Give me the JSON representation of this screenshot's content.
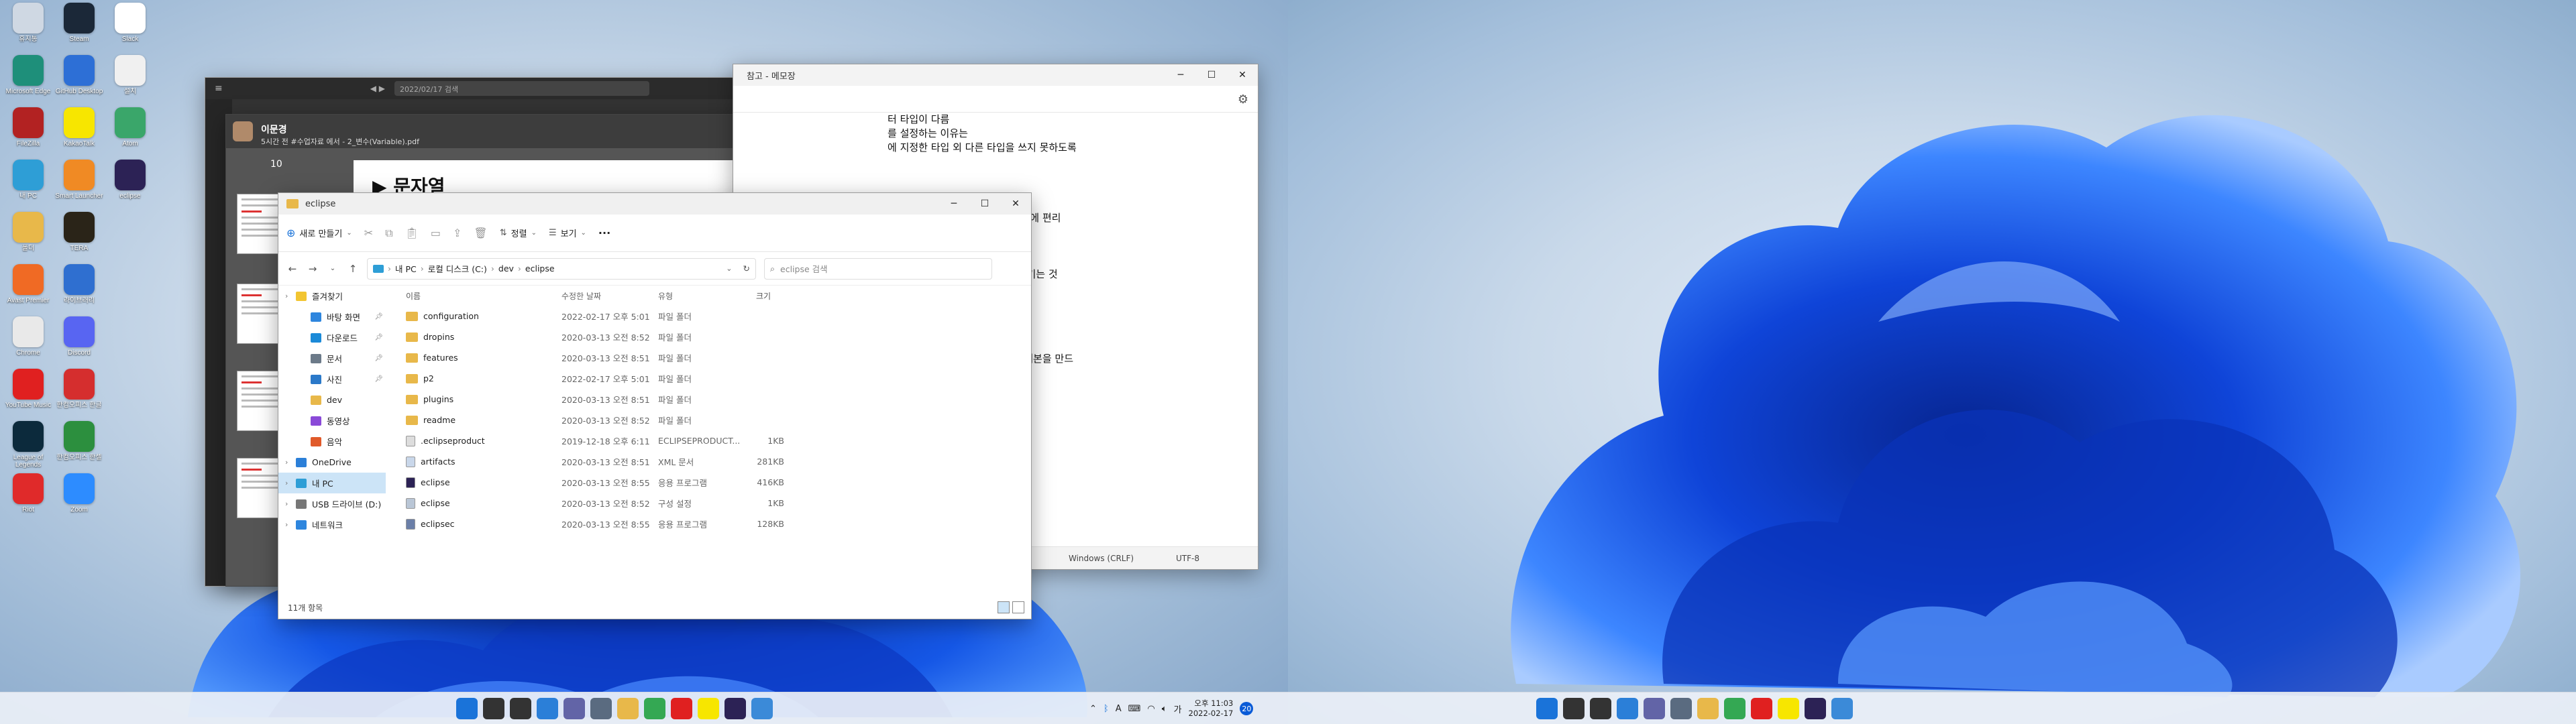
{
  "desktop_icons": [
    {
      "label": "휴지통",
      "icon": "recycle-bin-icon",
      "color": "#cfd8e3"
    },
    {
      "label": "Steam",
      "icon": "steam-icon",
      "color": "#1b2838"
    },
    {
      "label": "Slack",
      "icon": "slack-icon",
      "color": "#ffffff"
    },
    {
      "label": "Microsoft Edge",
      "icon": "edge-icon",
      "color": "#1e8f7a"
    },
    {
      "label": "GitHub Desktop",
      "icon": "github-desktop-icon",
      "color": "#2d6fd6"
    },
    {
      "label": "설치",
      "icon": "document-icon",
      "color": "#f0f0f0"
    },
    {
      "label": "FileZilla",
      "icon": "filezilla-icon",
      "color": "#b22222"
    },
    {
      "label": "KakaoTalk",
      "icon": "kakaotalk-icon",
      "color": "#f7e600"
    },
    {
      "label": "Atom",
      "icon": "atom-icon",
      "color": "#3aa66a"
    },
    {
      "label": "내 PC",
      "icon": "monitor-icon",
      "color": "#2e9ed6"
    },
    {
      "label": "Smart Launcher",
      "icon": "s-app-icon",
      "color": "#f08a24"
    },
    {
      "label": "eclipse",
      "icon": "eclipse-icon",
      "color": "#2c2255"
    },
    {
      "label": "폴더",
      "icon": "folder-icon",
      "color": "#e8b84a"
    },
    {
      "label": "TERA",
      "icon": "game-t-icon",
      "color": "#2a2418"
    },
    {
      "label": "",
      "icon": "blank",
      "color": "transparent"
    },
    {
      "label": "Avast Premier",
      "icon": "avast-icon",
      "color": "#f06a24"
    },
    {
      "label": "라이브러리",
      "icon": "bolt-app-icon",
      "color": "#2f6fd0"
    },
    {
      "label": "",
      "icon": "blank",
      "color": "transparent"
    },
    {
      "label": "Chrome",
      "icon": "chrome-icon",
      "color": "#e9e9e9"
    },
    {
      "label": "Discord",
      "icon": "discord-icon",
      "color": "#5865f2"
    },
    {
      "label": "",
      "icon": "blank",
      "color": "transparent"
    },
    {
      "label": "YouTube Music",
      "icon": "youtube-music-icon",
      "color": "#e02020"
    },
    {
      "label": "한컴오피스 한글",
      "icon": "hancom-icon",
      "color": "#d52e2e"
    },
    {
      "label": "",
      "icon": "blank",
      "color": "transparent"
    },
    {
      "label": "League of Legends",
      "icon": "lol-icon",
      "color": "#0c2a3c"
    },
    {
      "label": "한컴오피스 한셀",
      "icon": "hancell-icon",
      "color": "#2c8f3e"
    },
    {
      "label": "",
      "icon": "blank",
      "color": "transparent"
    },
    {
      "label": "Riot",
      "icon": "riot-icon",
      "color": "#e02a2a"
    },
    {
      "label": "Zoom",
      "icon": "zoom-icon",
      "color": "#2d8cff"
    }
  ],
  "pdf_window": {
    "search_placeholder": "2022/02/17 검색",
    "sender": "이문경",
    "meta": "5시간 전 #수업자료 에서 - 2_변수(Variable).pdf",
    "page_number": "10",
    "page_heading": "▶ 문자열"
  },
  "notepad": {
    "title": "참고 - 메모장",
    "lines": [
      "터 타입이 다름",
      "를 설정하는 이유는",
      "에 지정한 타입 외 다른 타입을 쓰지 못하도록",
      "",
      "",
      "",
      "",
      "사용된 요소가 한번에 바뀌기 때문에 편리",
      "있도록 하는 것이 중요",
      "",
      "것",
      "접하여 자동화하여 순차적으로 시키는 것",
      "",
      "",
      "",
      "",
      "들인 것",
      "값과 서로 같은 메소드를 가진 복제본을 만드"
    ],
    "status_encoding_line": "Windows (CRLF)",
    "status_charset": "UTF-8"
  },
  "explorer": {
    "title": "eclipse",
    "toolbar": {
      "new": "새로 만들기",
      "sort": "정렬",
      "view": "보기",
      "more": "···"
    },
    "address": [
      "내 PC",
      "로컬 디스크 (C:)",
      "dev",
      "eclipse"
    ],
    "search_placeholder": "eclipse 검색",
    "nav": [
      {
        "label": "즐겨찾기",
        "icon": "star-icon",
        "color": "#f2c531",
        "pinned": false,
        "indent": 0,
        "selected": false
      },
      {
        "label": "바탕 화면",
        "icon": "desktop-icon",
        "color": "#2e86de",
        "pinned": true,
        "indent": 1,
        "selected": false
      },
      {
        "label": "다운로드",
        "icon": "download-icon",
        "color": "#1b8ad8",
        "pinned": true,
        "indent": 1,
        "selected": false
      },
      {
        "label": "문서",
        "icon": "documents-icon",
        "color": "#6c7a89",
        "pinned": true,
        "indent": 1,
        "selected": false
      },
      {
        "label": "사진",
        "icon": "pictures-icon",
        "color": "#2b79c9",
        "pinned": true,
        "indent": 1,
        "selected": false
      },
      {
        "label": "dev",
        "icon": "folder-icon",
        "color": "#e8b84a",
        "pinned": false,
        "indent": 1,
        "selected": false
      },
      {
        "label": "동영상",
        "icon": "videos-icon",
        "color": "#8a4ad8",
        "pinned": false,
        "indent": 1,
        "selected": false
      },
      {
        "label": "음악",
        "icon": "music-icon",
        "color": "#e05a2a",
        "pinned": false,
        "indent": 1,
        "selected": false
      },
      {
        "label": "OneDrive",
        "icon": "onedrive-icon",
        "color": "#2b7fd8",
        "pinned": false,
        "indent": 0,
        "selected": false
      },
      {
        "label": "내 PC",
        "icon": "pc-icon",
        "color": "#2e9ed6",
        "pinned": false,
        "indent": 0,
        "selected": true
      },
      {
        "label": "USB 드라이브 (D:)",
        "icon": "usb-drive-icon",
        "color": "#777777",
        "pinned": false,
        "indent": 0,
        "selected": false
      },
      {
        "label": "네트워크",
        "icon": "network-icon",
        "color": "#2e86de",
        "pinned": false,
        "indent": 0,
        "selected": false
      }
    ],
    "columns": {
      "name": "이름",
      "date": "수정한 날짜",
      "type": "유형",
      "size": "크기"
    },
    "files": [
      {
        "name": "configuration",
        "date": "2022-02-17 오후 5:01",
        "type": "파일 폴더",
        "size": "",
        "icon": "folder-icon",
        "color": "#e8b84a"
      },
      {
        "name": "dropins",
        "date": "2020-03-13 오전 8:52",
        "type": "파일 폴더",
        "size": "",
        "icon": "folder-icon",
        "color": "#e8b84a"
      },
      {
        "name": "features",
        "date": "2020-03-13 오전 8:51",
        "type": "파일 폴더",
        "size": "",
        "icon": "folder-icon",
        "color": "#e8b84a"
      },
      {
        "name": "p2",
        "date": "2022-02-17 오후 5:01",
        "type": "파일 폴더",
        "size": "",
        "icon": "folder-icon",
        "color": "#e8b84a"
      },
      {
        "name": "plugins",
        "date": "2020-03-13 오전 8:51",
        "type": "파일 폴더",
        "size": "",
        "icon": "folder-icon",
        "color": "#e8b84a"
      },
      {
        "name": "readme",
        "date": "2020-03-13 오전 8:52",
        "type": "파일 폴더",
        "size": "",
        "icon": "folder-icon",
        "color": "#e8b84a"
      },
      {
        "name": ".eclipseproduct",
        "date": "2019-12-18 오후 6:11",
        "type": "ECLIPSEPRODUCT...",
        "size": "1KB",
        "icon": "file-icon",
        "color": "#dddddd"
      },
      {
        "name": "artifacts",
        "date": "2020-03-13 오전 8:51",
        "type": "XML 문서",
        "size": "281KB",
        "icon": "xml-file-icon",
        "color": "#c9d7ea"
      },
      {
        "name": "eclipse",
        "date": "2020-03-13 오전 8:55",
        "type": "응용 프로그램",
        "size": "416KB",
        "icon": "eclipse-icon",
        "color": "#2c2255"
      },
      {
        "name": "eclipse",
        "date": "2020-03-13 오전 8:52",
        "type": "구성 설정",
        "size": "1KB",
        "icon": "settings-file-icon",
        "color": "#b9c6d6"
      },
      {
        "name": "eclipsec",
        "date": "2020-03-13 오전 8:55",
        "type": "응용 프로그램",
        "size": "128KB",
        "icon": "app-file-icon",
        "color": "#6b7fa8"
      }
    ],
    "status": "11개 항목"
  },
  "taskbar": {
    "apps": [
      {
        "icon": "start-icon",
        "color": "#1a73d9"
      },
      {
        "icon": "search-icon",
        "color": "#333333"
      },
      {
        "icon": "task-view-icon",
        "color": "#333333"
      },
      {
        "icon": "widgets-icon",
        "color": "#2b7fd8"
      },
      {
        "icon": "teams-chat-icon",
        "color": "#6264a7"
      },
      {
        "icon": "settings-icon",
        "color": "#5a6b80"
      },
      {
        "icon": "file-explorer-icon",
        "color": "#e8b84a"
      },
      {
        "icon": "chrome-icon",
        "color": "#34a853"
      },
      {
        "icon": "youtube-music-icon",
        "color": "#e02020"
      },
      {
        "icon": "kakaotalk-icon",
        "color": "#f7e600"
      },
      {
        "icon": "eclipse-icon",
        "color": "#2c2255"
      },
      {
        "icon": "notepad-icon",
        "color": "#3b8ad8"
      }
    ],
    "tray_ime": "A",
    "tray_ime2": "가",
    "time": "오후 11:03",
    "date": "2022-02-17",
    "notifications": "20"
  }
}
